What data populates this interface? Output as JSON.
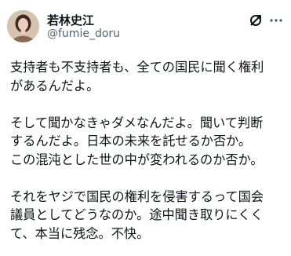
{
  "author": {
    "name": "若林史江",
    "handle": "@fumie_doru"
  },
  "actions": {
    "grok_icon": "grok-icon",
    "more_icon": "more-horizontal-icon"
  },
  "tweet": {
    "text": "支持者も不支持者も、全ての国民に聞く権利\nがあるんだよ。\n\nそして聞かなきゃダメなんだよ。聞いて判断\nするんだよ。日本の未来を託せるか否か。\nこの混沌とした世の中が変われるのか否か。\n\nそれをヤジで国民の権利を侵害するって国会\n議員としてどうなのか。途中聞き取りにくく\nて、本当に残念。不快。"
  },
  "colors": {
    "text_primary": "#0f1419",
    "text_secondary": "#536471",
    "background": "#ffffff"
  }
}
